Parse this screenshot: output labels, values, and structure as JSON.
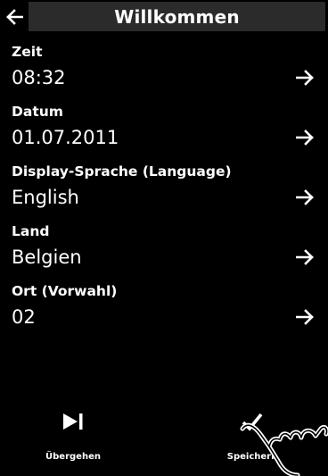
{
  "header": {
    "back_icon": "left-arrow-icon",
    "title": "Willkommen"
  },
  "settings": [
    {
      "label": "Zeit",
      "value": "08:32",
      "icon": "right-arrow-icon"
    },
    {
      "label": "Datum",
      "value": "01.07.2011",
      "icon": "right-arrow-icon"
    },
    {
      "label": "Display-Sprache (Language)",
      "value": "English",
      "icon": "right-arrow-icon"
    },
    {
      "label": "Land",
      "value": "Belgien",
      "icon": "right-arrow-icon"
    },
    {
      "label": "Ort (Vorwahl)",
      "value": "02",
      "icon": "right-arrow-icon"
    }
  ],
  "footer": {
    "skip": {
      "label": "Übergehen",
      "icon": "skip-icon"
    },
    "save": {
      "label": "Speichern",
      "icon": "checkmark-icon"
    }
  },
  "colors": {
    "background": "#000000",
    "title_bar": "#2b2b2b",
    "text": "#ffffff"
  }
}
